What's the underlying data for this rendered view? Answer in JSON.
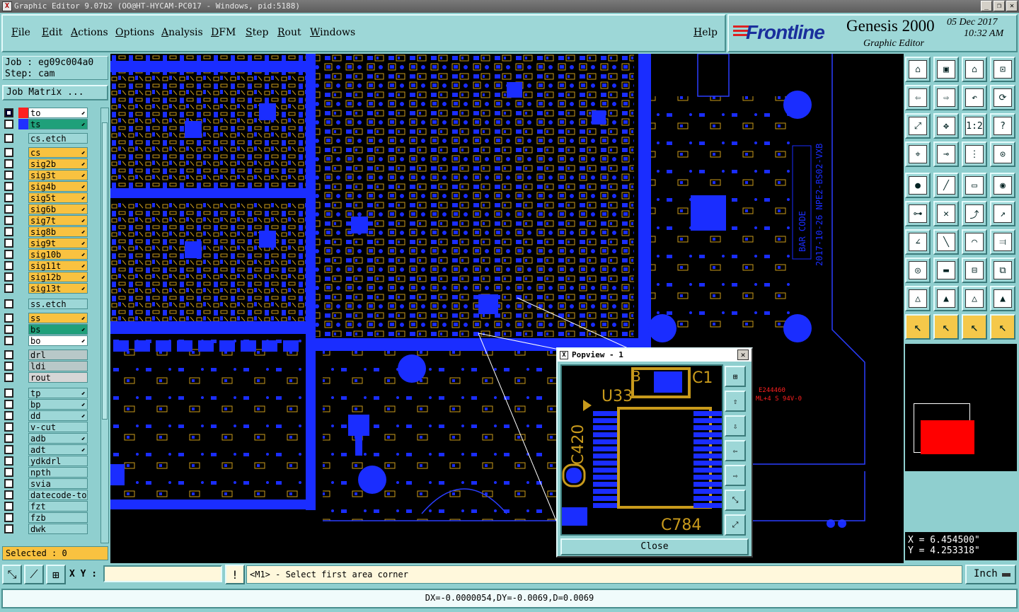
{
  "window": {
    "title": "Graphic Editor 9.07b2 (OO@HT-HYCAM-PC017 - Windows, pid:5188)"
  },
  "menu": {
    "items": [
      "File",
      "Edit",
      "Actions",
      "Options",
      "Analysis",
      "DFM",
      "Step",
      "Rout",
      "Windows"
    ],
    "help": "Help"
  },
  "brand": {
    "logo": "Frontline",
    "product": "Genesis 2000",
    "subtitle": "Graphic Editor",
    "date": "05 Dec 2017",
    "time": "10:32 AM"
  },
  "job": {
    "job_line": "Job : eg09c004a0",
    "step_line": "Step: cam",
    "matrix_button": "Job Matrix ..."
  },
  "layers": [
    {
      "name": "to",
      "color": "#ffffff",
      "swatch": "#ff2020",
      "checked": true,
      "arrow": "⬋"
    },
    {
      "name": "ts",
      "color": "#1fa07a",
      "swatch": "#2030ff",
      "checked": false,
      "arrow": "⬋"
    },
    {
      "name": "cs.etch",
      "color": "#9dd7d7",
      "swatch": "",
      "checked": false,
      "arrow": ""
    },
    {
      "name": "cs",
      "color": "#f9c240",
      "swatch": "",
      "checked": false,
      "arrow": "⬋"
    },
    {
      "name": "sig2b",
      "color": "#f9c240",
      "swatch": "",
      "checked": false,
      "arrow": "⬋"
    },
    {
      "name": "sig3t",
      "color": "#f9c240",
      "swatch": "",
      "checked": false,
      "arrow": "⬋"
    },
    {
      "name": "sig4b",
      "color": "#f9c240",
      "swatch": "",
      "checked": false,
      "arrow": "⬋"
    },
    {
      "name": "sig5t",
      "color": "#f9c240",
      "swatch": "",
      "checked": false,
      "arrow": "⬋"
    },
    {
      "name": "sig6b",
      "color": "#f9c240",
      "swatch": "",
      "checked": false,
      "arrow": "⬋"
    },
    {
      "name": "sig7t",
      "color": "#f9c240",
      "swatch": "",
      "checked": false,
      "arrow": "⬋"
    },
    {
      "name": "sig8b",
      "color": "#f9c240",
      "swatch": "",
      "checked": false,
      "arrow": "⬋"
    },
    {
      "name": "sig9t",
      "color": "#f9c240",
      "swatch": "",
      "checked": false,
      "arrow": "⬋"
    },
    {
      "name": "sig10b",
      "color": "#f9c240",
      "swatch": "",
      "checked": false,
      "arrow": "⬋"
    },
    {
      "name": "sig11t",
      "color": "#f9c240",
      "swatch": "",
      "checked": false,
      "arrow": "⬋"
    },
    {
      "name": "sig12b",
      "color": "#f9c240",
      "swatch": "",
      "checked": false,
      "arrow": "⬋"
    },
    {
      "name": "sig13t",
      "color": "#f9c240",
      "swatch": "",
      "checked": false,
      "arrow": "⬋"
    },
    {
      "name": "ss.etch",
      "color": "#9dd7d7",
      "swatch": "",
      "checked": false,
      "arrow": ""
    },
    {
      "name": "ss",
      "color": "#f9c240",
      "swatch": "",
      "checked": false,
      "arrow": "⬋"
    },
    {
      "name": "bs",
      "color": "#1fa07a",
      "swatch": "",
      "checked": false,
      "arrow": "⬋"
    },
    {
      "name": "bo",
      "color": "#ffffff",
      "swatch": "",
      "checked": false,
      "arrow": "⬋"
    },
    {
      "name": "drl",
      "color": "#b8c8c8",
      "swatch": "",
      "checked": false,
      "arrow": ""
    },
    {
      "name": "ldi",
      "color": "#b8c8c8",
      "swatch": "",
      "checked": false,
      "arrow": ""
    },
    {
      "name": "rout",
      "color": "#d6d6d6",
      "swatch": "",
      "checked": false,
      "arrow": ""
    },
    {
      "name": "tp",
      "color": "#9dd7d7",
      "swatch": "",
      "checked": false,
      "arrow": "⬋"
    },
    {
      "name": "bp",
      "color": "#9dd7d7",
      "swatch": "",
      "checked": false,
      "arrow": "⬋"
    },
    {
      "name": "dd",
      "color": "#9dd7d7",
      "swatch": "",
      "checked": false,
      "arrow": "⬋"
    },
    {
      "name": "v-cut",
      "color": "#9dd7d7",
      "swatch": "",
      "checked": false,
      "arrow": ""
    },
    {
      "name": "adb",
      "color": "#9dd7d7",
      "swatch": "",
      "checked": false,
      "arrow": "⬋"
    },
    {
      "name": "adt",
      "color": "#9dd7d7",
      "swatch": "",
      "checked": false,
      "arrow": "⬋"
    },
    {
      "name": "ydkdrl",
      "color": "#9dd7d7",
      "swatch": "",
      "checked": false,
      "arrow": ""
    },
    {
      "name": "npth",
      "color": "#9dd7d7",
      "swatch": "",
      "checked": false,
      "arrow": ""
    },
    {
      "name": "svia",
      "color": "#9dd7d7",
      "swatch": "",
      "checked": false,
      "arrow": ""
    },
    {
      "name": "datecode-to",
      "color": "#9dd7d7",
      "swatch": "",
      "checked": false,
      "arrow": ""
    },
    {
      "name": "fzt",
      "color": "#9dd7d7",
      "swatch": "",
      "checked": false,
      "arrow": ""
    },
    {
      "name": "fzb",
      "color": "#9dd7d7",
      "swatch": "",
      "checked": false,
      "arrow": ""
    },
    {
      "name": "dwk",
      "color": "#9dd7d7",
      "swatch": "",
      "checked": false,
      "arrow": ""
    }
  ],
  "selected_label": "Selected : 0",
  "board": {
    "silk_text_1": "BAR CODE",
    "silk_text_2": "2017-10-26 NPE2-BS02-VXB",
    "red_text_1": "E244460",
    "red_text_2": "ML+4 S 94V-0"
  },
  "popview": {
    "title": "Popview - 1",
    "close_label": "Close",
    "labels": [
      "U33",
      "C420",
      "C784",
      "C1",
      "B"
    ]
  },
  "coords": {
    "x": "X =  6.454500\"",
    "y": "Y =  4.253318\""
  },
  "bottom": {
    "xy_label": "X Y :",
    "xy_value": "",
    "status_text": "<M1> - Select first area corner",
    "units": "Inch",
    "delta": "DX=-0.0000054,DY=-0.0069,D=0.0069"
  }
}
